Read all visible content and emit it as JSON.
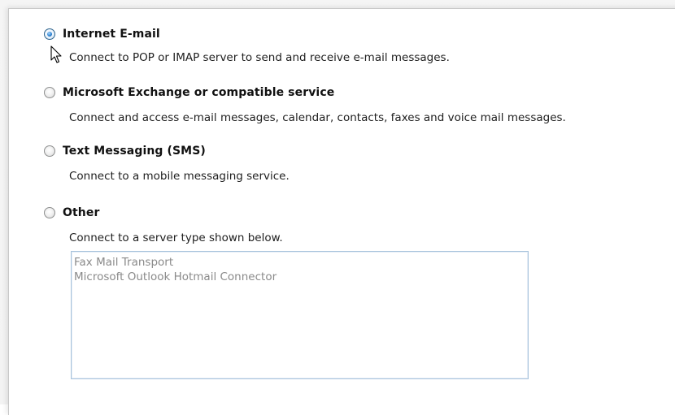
{
  "options": [
    {
      "label": "Internet E-mail",
      "description": "Connect to POP or IMAP server to send and receive e-mail messages.",
      "selected": true
    },
    {
      "label": "Microsoft Exchange or compatible service",
      "description": "Connect and access e-mail messages, calendar, contacts, faxes and voice mail messages.",
      "selected": false
    },
    {
      "label": "Text Messaging (SMS)",
      "description": "Connect to a mobile messaging service.",
      "selected": false
    },
    {
      "label": "Other",
      "description": "Connect to a server type shown below.",
      "selected": false
    }
  ],
  "other_list": {
    "items": [
      "Fax Mail Transport",
      "Microsoft Outlook Hotmail Connector"
    ]
  },
  "colors": {
    "selected_radio": "#2f84d2",
    "disabled_text": "#8a8a8a",
    "listbox_border": "#a8c3dc"
  }
}
